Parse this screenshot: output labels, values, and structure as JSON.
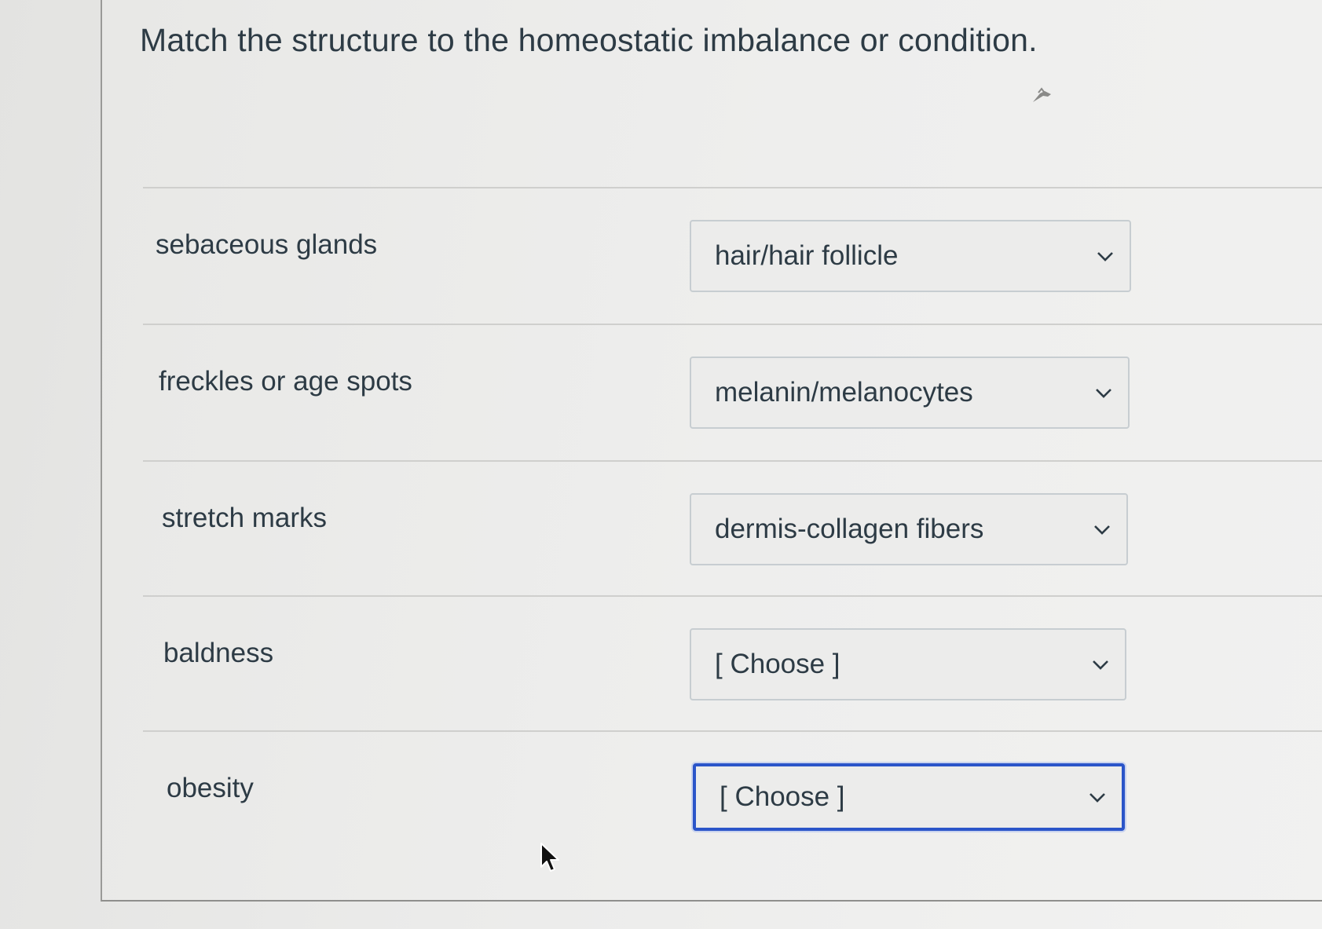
{
  "question": {
    "prompt": "Match the structure to the homeostatic imbalance or condition."
  },
  "rows": [
    {
      "label": "sebaceous glands",
      "selected": "hair/hair follicle",
      "focused": false
    },
    {
      "label": "freckles or age spots",
      "selected": "melanin/melanocytes",
      "focused": false
    },
    {
      "label": "stretch marks",
      "selected": "dermis-collagen fibers",
      "focused": false
    },
    {
      "label": "baldness",
      "selected": "[ Choose ]",
      "focused": false
    },
    {
      "label": "obesity",
      "selected": "[ Choose ]",
      "focused": true
    }
  ],
  "icons": {
    "dropdown": "chevron-down-icon",
    "pin": "pin-icon",
    "cursor": "mouse-cursor-icon"
  },
  "colors": {
    "text": "#2d3b45",
    "focus_border": "#2b55c9",
    "select_border": "#c7cdd1",
    "background": "#ebebea"
  }
}
